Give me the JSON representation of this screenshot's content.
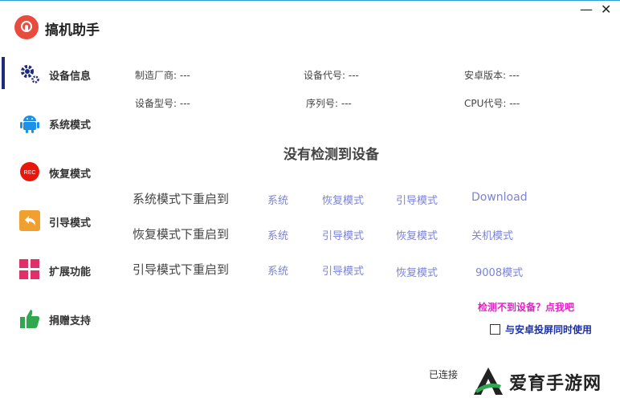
{
  "app": {
    "title": "搞机助手"
  },
  "window": {
    "minimize": "—",
    "close": "✕"
  },
  "sidebar": {
    "items": [
      {
        "label": "设备信息",
        "icon": "gear-icon",
        "active": true
      },
      {
        "label": "系统模式",
        "icon": "android-icon"
      },
      {
        "label": "恢复模式",
        "icon": "rec-icon",
        "icon_text": "REC"
      },
      {
        "label": "引导模式",
        "icon": "back-arrow-icon"
      },
      {
        "label": "扩展功能",
        "icon": "grid-icon"
      },
      {
        "label": "捐赠支持",
        "icon": "thumbs-up-icon"
      }
    ]
  },
  "device_info": {
    "manufacturer": "制造厂商: ---",
    "codename": "设备代号: ---",
    "android_version": "安卓版本: ---",
    "model": "设备型号: ---",
    "serial": "序列号: ---",
    "cpu": "CPU代号: ---"
  },
  "status_heading": "没有检测到设备",
  "reboot_rows": [
    {
      "label": "系统模式下重启到",
      "options": [
        "系统",
        "恢复模式",
        "引导模式",
        "Download"
      ]
    },
    {
      "label": "恢复模式下重启到",
      "options": [
        "系统",
        "引导模式",
        "恢复模式",
        "关机模式"
      ]
    },
    {
      "label": "引导模式下重启到",
      "options": [
        "系统",
        "引导模式",
        "恢复模式",
        "9008模式"
      ]
    }
  ],
  "help_link": "检测不到设备？点我吧",
  "screen_cast_checkbox": {
    "label": "与安卓投屏同时使用",
    "checked": false
  },
  "connection_status": "已连接",
  "watermark": {
    "text": "爱育手游网"
  },
  "colors": {
    "accent": "#1e2a7a",
    "link": "#7b83d6",
    "help": "#e51fc8"
  }
}
